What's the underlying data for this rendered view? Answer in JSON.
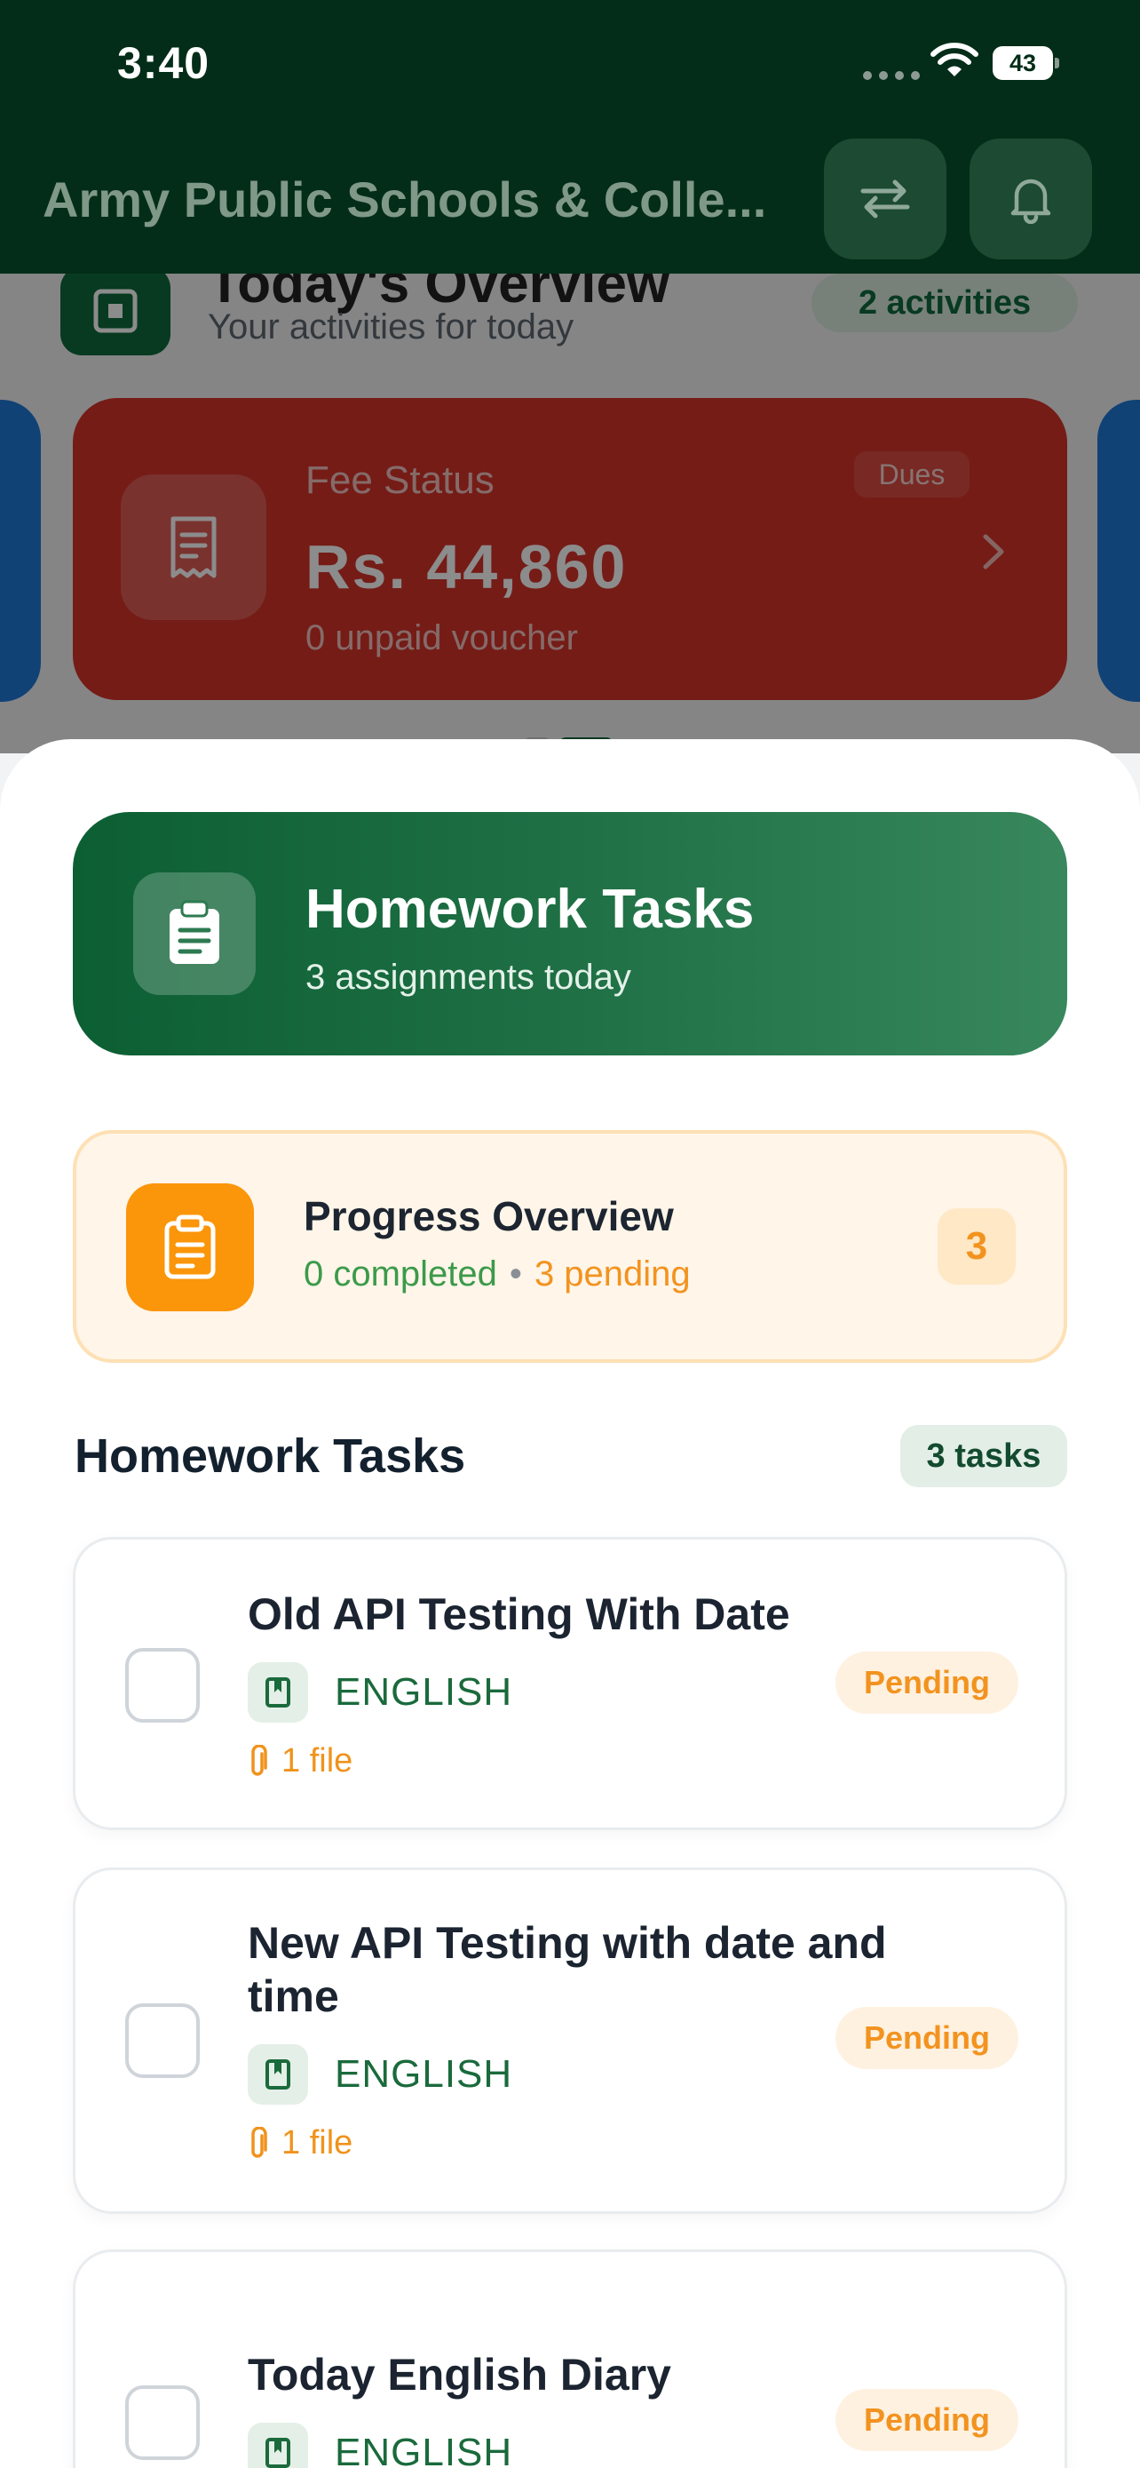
{
  "status_bar": {
    "time": "3:40",
    "battery": "43"
  },
  "header": {
    "title": "Army Public Schools & Colle..."
  },
  "overview": {
    "title": "Today's Overview",
    "subtitle": "Your activities for today",
    "badge": "2 activities"
  },
  "fee_card": {
    "label": "Fee Status",
    "amount": "Rs. 44,860",
    "subtitle": "0 unpaid voucher",
    "tag": "Dues",
    "accent": "#d6332a"
  },
  "homework_banner": {
    "title": "Homework Tasks",
    "subtitle": "3 assignments today",
    "accent": "#0c5f33"
  },
  "progress": {
    "title": "Progress Overview",
    "completed": "0 completed",
    "separator": "•",
    "pending": "3 pending",
    "count": "3",
    "accent": "#fb9509"
  },
  "tasks_section": {
    "title": "Homework Tasks",
    "badge": "3 tasks"
  },
  "tasks": [
    {
      "title": "Old API Testing With Date",
      "subject": "ENGLISH",
      "files": "1 file",
      "status": "Pending"
    },
    {
      "title": "New API Testing with date and time",
      "subject": "ENGLISH",
      "files": "1 file",
      "status": "Pending"
    },
    {
      "title": "Today English Diary",
      "subject": "ENGLISH",
      "status": "Pending"
    }
  ],
  "icons": [
    "wifi-icon",
    "battery-icon",
    "swap-icon",
    "bell-icon",
    "receipt-icon",
    "chevron-right-icon",
    "clipboard-icon",
    "book-icon",
    "paperclip-icon"
  ]
}
